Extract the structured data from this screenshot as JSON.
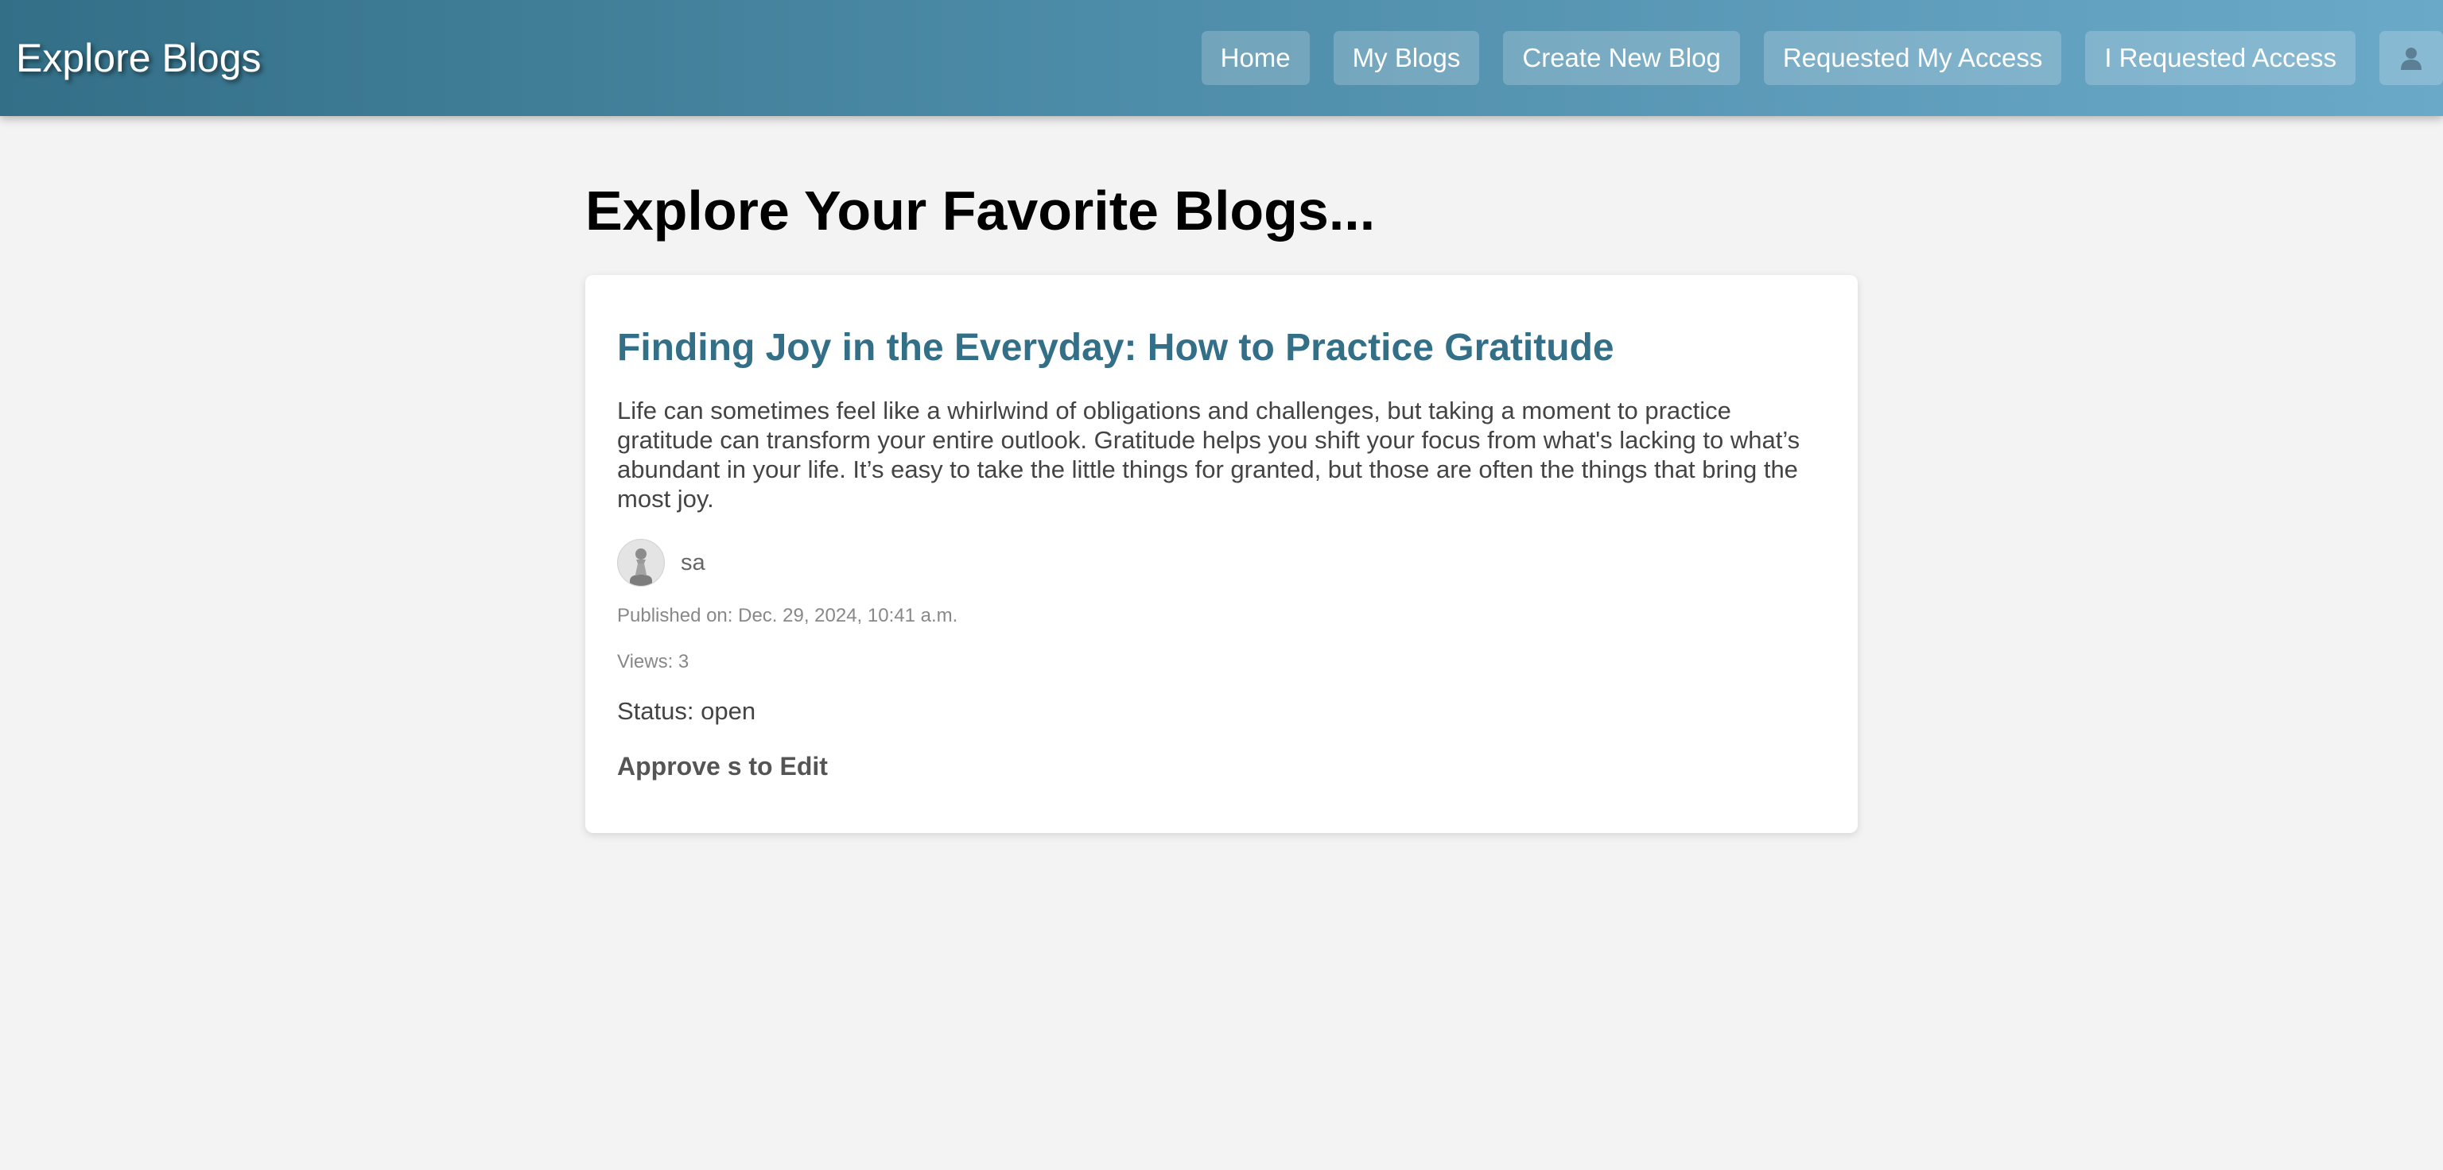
{
  "navbar": {
    "brand": "Explore Blogs",
    "links": [
      {
        "label": "Home"
      },
      {
        "label": "My Blogs"
      },
      {
        "label": "Create New Blog"
      },
      {
        "label": "Requested My Access"
      },
      {
        "label": "I Requested Access"
      }
    ],
    "user_icon": "user-icon"
  },
  "main": {
    "page_title": "Explore Your Favorite Blogs...",
    "post": {
      "title": "Finding Joy in the Everyday: How to Practice Gratitude",
      "excerpt": "Life can sometimes feel like a whirlwind of obligations and challenges, but taking a moment to practice gratitude can transform your entire outlook. Gratitude helps you shift your focus from what's lacking to what’s abundant in your life. It’s easy to take the little things for granted, but those are often the things that bring the most joy.",
      "author": "sa",
      "avatar_icon": "pawn-avatar",
      "published": "Published on: Dec. 29, 2024, 10:41 a.m.",
      "views": "Views: 3",
      "status": "Status: open",
      "approve_text": "Approve s to Edit"
    }
  },
  "colors": {
    "navbar_start": "#336f87",
    "navbar_end": "#6ba9c9",
    "accent": "#336f87",
    "page_background": "#f3f3f3"
  }
}
